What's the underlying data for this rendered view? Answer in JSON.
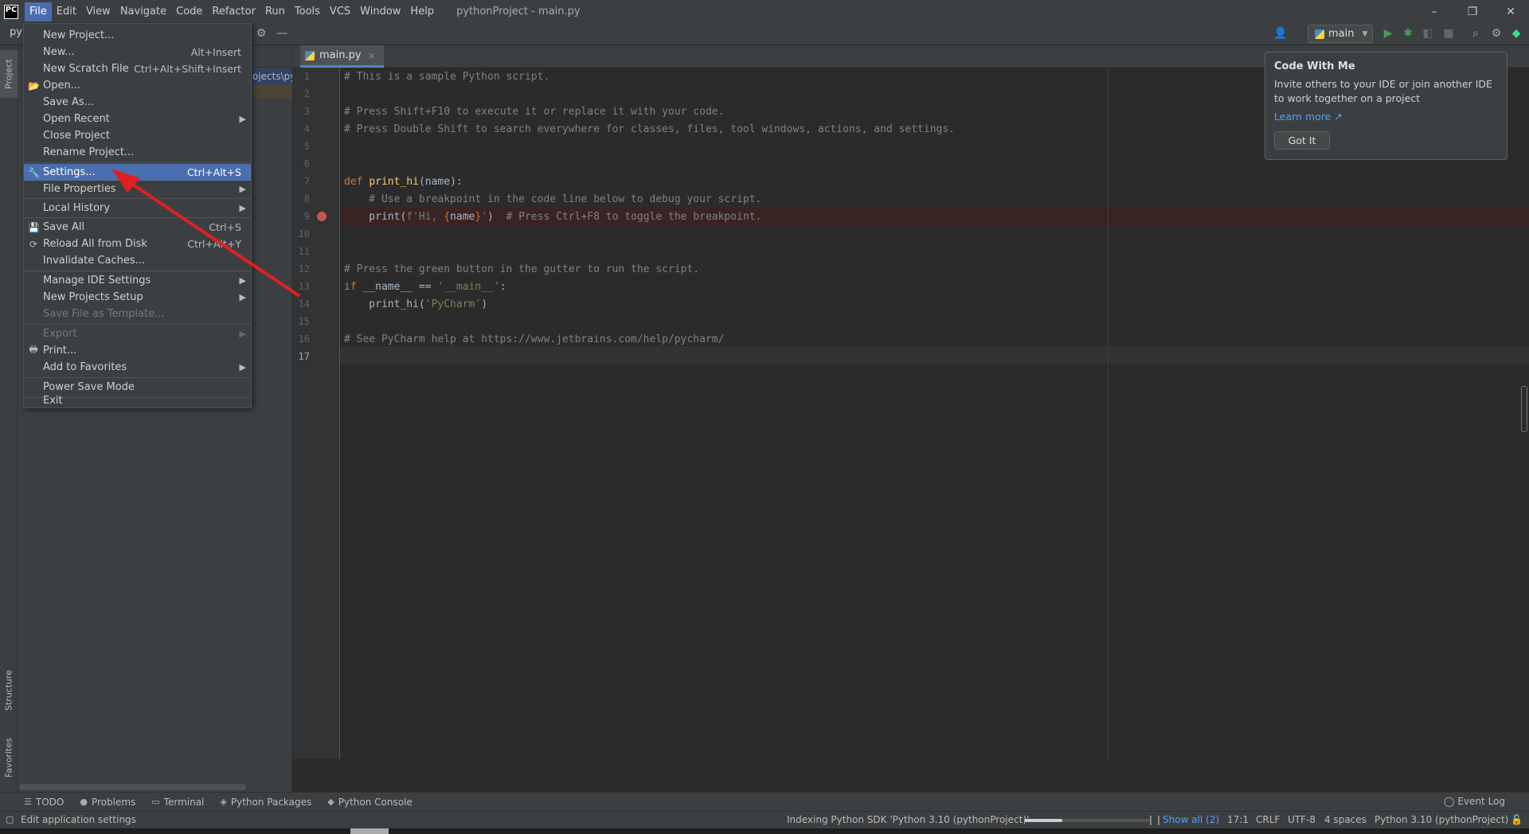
{
  "app": {
    "logo": "PC",
    "window_title": "pythonProject - main.py",
    "window_controls": [
      "–",
      "❐",
      "✕"
    ]
  },
  "menubar": [
    "File",
    "Edit",
    "View",
    "Navigate",
    "Code",
    "Refactor",
    "Run",
    "Tools",
    "VCS",
    "Window",
    "Help"
  ],
  "toolbar": {
    "project_crumb": "pyt",
    "run_config": "main"
  },
  "side_tabs": {
    "project": "Project",
    "structure": "Structure",
    "favorites": "Favorites"
  },
  "project_panel": {
    "path_fragment": "ojects\\py"
  },
  "editor_tab": {
    "filename": "main.py",
    "close": "×"
  },
  "code": {
    "line_numbers": [
      "1",
      "2",
      "3",
      "4",
      "5",
      "6",
      "7",
      "8",
      "9",
      "10",
      "11",
      "12",
      "13",
      "14",
      "15",
      "16",
      "17"
    ],
    "l1": "# This is a sample Python script.",
    "l3": "# Press Shift+F10 to execute it or replace it with your code.",
    "l4": "# Press Double Shift to search everywhere for classes, files, tool windows, actions, and settings.",
    "l7_kw": "def",
    "l7_fn": "print_hi",
    "l7_rest": "(name):",
    "l8": "    # Use a breakpoint in the code line below to debug your script.",
    "l9_a": "    print(",
    "l9_str1": "f'Hi, ",
    "l9_brace_open": "{",
    "l9_name": "name",
    "l9_brace_close": "}",
    "l9_str2": "'",
    "l9_b": ")  ",
    "l9_com": "# Press Ctrl+F8 to toggle the breakpoint.",
    "l12": "# Press the green button in the gutter to run the script.",
    "l13_kw": "if",
    "l13_a": " __name__ == ",
    "l13_str": "'__main__'",
    "l13_b": ":",
    "l14_a": "    print_hi(",
    "l14_str": "'PyCharm'",
    "l14_b": ")",
    "l16": "# See PyCharm help at https://www.jetbrains.com/help/pycharm/"
  },
  "popup": {
    "title": "Code With Me",
    "body": "Invite others to your IDE or join another IDE to work together on a project",
    "link": "Learn more ↗",
    "button": "Got It"
  },
  "file_menu": {
    "items": [
      {
        "label": "New Project...",
        "shortcut": ""
      },
      {
        "label": "New...",
        "shortcut": "Alt+Insert"
      },
      {
        "label": "New Scratch File",
        "shortcut": "Ctrl+Alt+Shift+Insert"
      },
      {
        "label": "Open...",
        "shortcut": ""
      },
      {
        "label": "Save As...",
        "shortcut": ""
      },
      {
        "label": "Open Recent",
        "shortcut": ""
      },
      {
        "label": "Close Project",
        "shortcut": ""
      },
      {
        "label": "Rename Project...",
        "shortcut": ""
      },
      {
        "label": "Settings...",
        "shortcut": "Ctrl+Alt+S"
      },
      {
        "label": "File Properties",
        "shortcut": ""
      },
      {
        "label": "Local History",
        "shortcut": ""
      },
      {
        "label": "Save All",
        "shortcut": "Ctrl+S"
      },
      {
        "label": "Reload All from Disk",
        "shortcut": "Ctrl+Alt+Y"
      },
      {
        "label": "Invalidate Caches...",
        "shortcut": ""
      },
      {
        "label": "Manage IDE Settings",
        "shortcut": ""
      },
      {
        "label": "New Projects Setup",
        "shortcut": ""
      },
      {
        "label": "Save File as Template...",
        "shortcut": ""
      },
      {
        "label": "Export",
        "shortcut": ""
      },
      {
        "label": "Print...",
        "shortcut": ""
      },
      {
        "label": "Add to Favorites",
        "shortcut": ""
      },
      {
        "label": "Power Save Mode",
        "shortcut": ""
      },
      {
        "label": "Exit",
        "shortcut": ""
      }
    ]
  },
  "bottom_tools": [
    "TODO",
    "Problems",
    "Terminal",
    "Python Packages",
    "Python Console"
  ],
  "event_log": "Event Log",
  "status": {
    "message": "Edit application settings",
    "indexing": "Indexing Python SDK 'Python 3.10 (pythonProject)'",
    "show_all": "Show all (2)",
    "position": "17:1",
    "line_sep": "CRLF",
    "encoding": "UTF-8",
    "indent": "4 spaces",
    "interpreter": "Python 3.10 (pythonProject)"
  },
  "colors": {
    "selection": "#4b6eaf",
    "annotation_arrow": "#e02020",
    "breakpoint": "#c75450"
  }
}
